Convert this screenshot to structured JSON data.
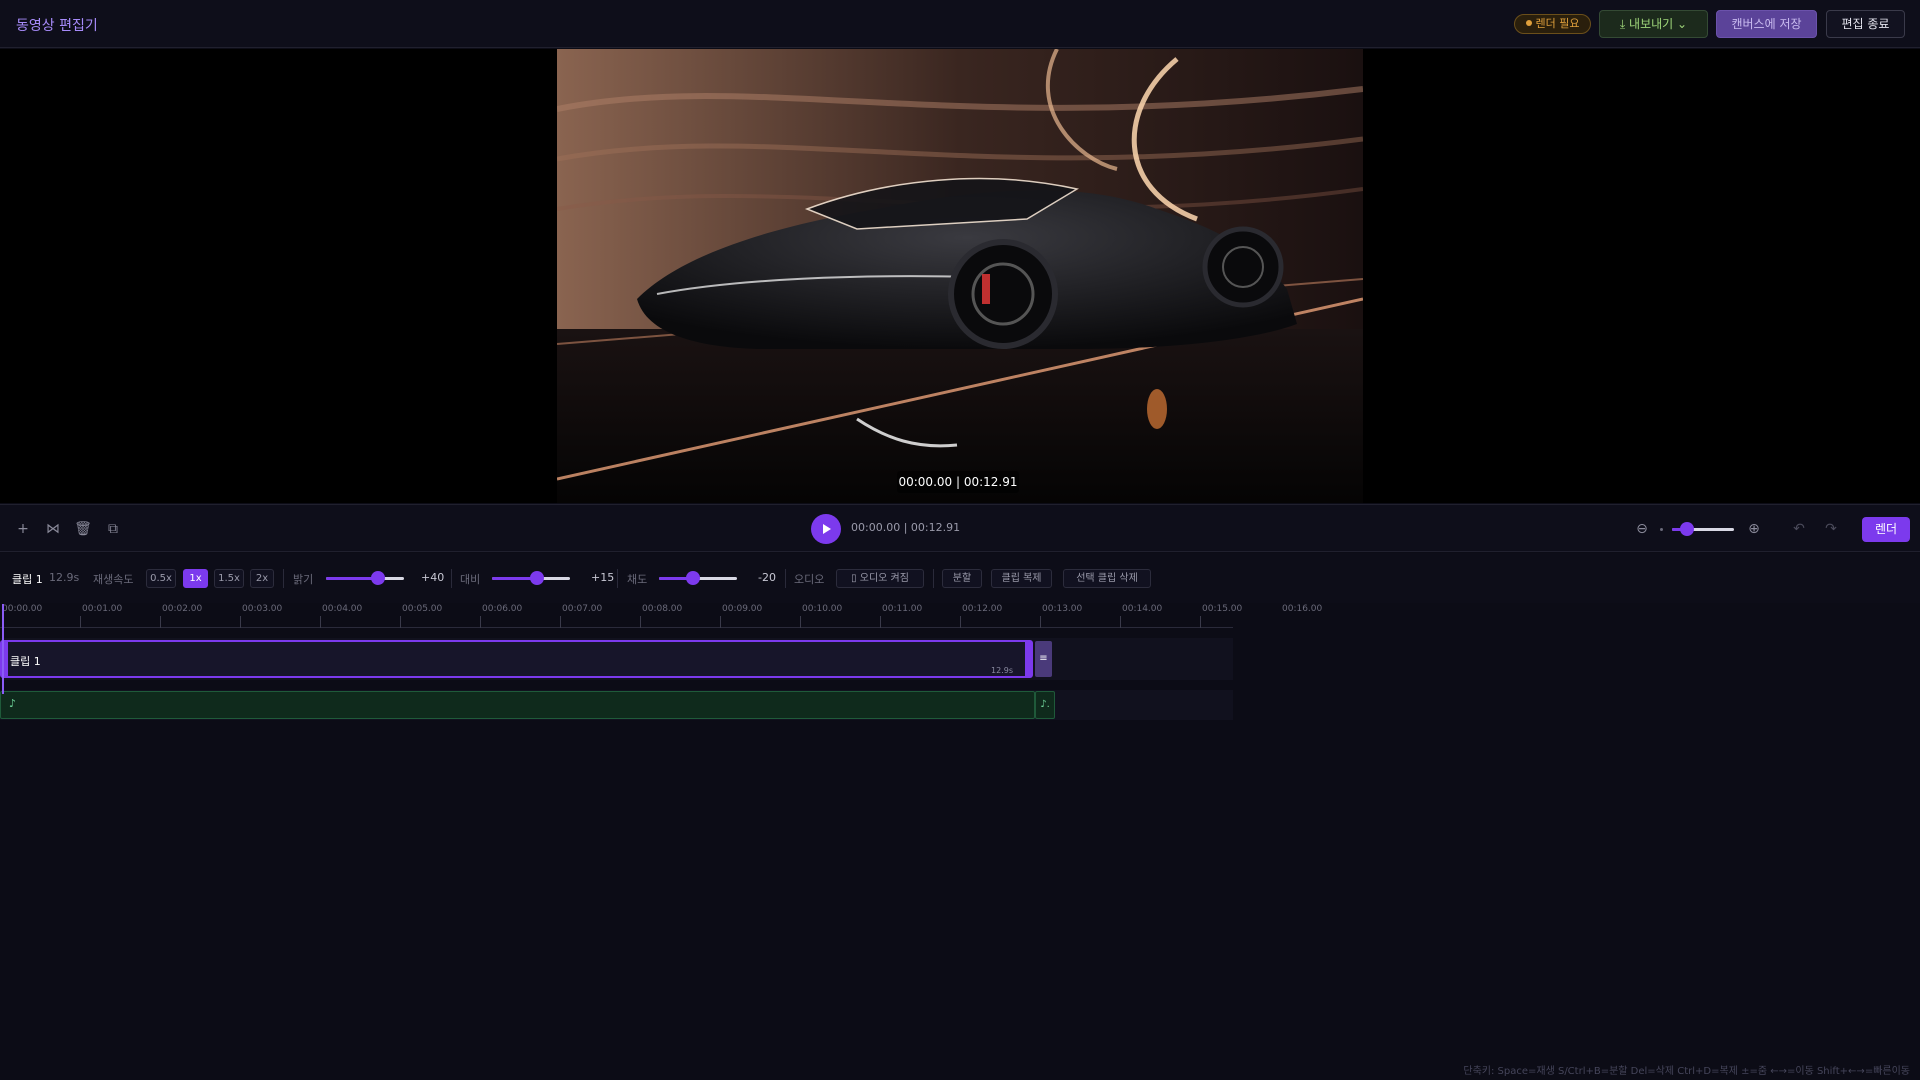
{
  "header": {
    "title": "동영상 편집기",
    "render_needed": "렌더 필요",
    "export_label": "내보내기",
    "save_canvas_label": "캔버스에 저장",
    "exit_label": "편집 종료"
  },
  "preview": {
    "current_time": "00:00.00",
    "total_time": "00:12.91"
  },
  "transport": {
    "time": "00:00.00 | 00:12.91",
    "render_label": "렌더"
  },
  "props": {
    "clip_name": "클립 1",
    "clip_duration": "12.9s",
    "speed_label": "재생속도",
    "speeds": [
      "0.5x",
      "1x",
      "1.5x",
      "2x"
    ],
    "selected_speed": "1x",
    "brightness_label": "밝기",
    "brightness_value": "+40",
    "contrast_label": "대비",
    "contrast_value": "+15",
    "saturation_label": "채도",
    "saturation_value": "-20",
    "audio_label": "오디오",
    "audio_toggle": "▯ 오디오 켜짐",
    "split_label": "분할",
    "duplicate_label": "클립 복제",
    "delete_label": "선택 클립 삭제"
  },
  "timeline": {
    "ticks": [
      "00:00.00",
      "00:01.00",
      "00:02.00",
      "00:03.00",
      "00:04.00",
      "00:05.00",
      "00:06.00",
      "00:07.00",
      "00:08.00",
      "00:09.00",
      "00:10.00",
      "00:11.00",
      "00:12.00",
      "00:13.00",
      "00:14.00",
      "00:15.00",
      "00:16.00"
    ],
    "clip_label": "클립 1",
    "clip_duration": "12.9s",
    "audio_note": "♪",
    "audio_end": "♪."
  },
  "shortcuts": "단축키: Space=재생 S/Ctrl+B=분할 Del=삭제 Ctrl+D=복제 ±=줌 ←→=이동 Shift+←→=빠른이동",
  "colors": {
    "accent": "#7c3aed",
    "background": "#0c0c16",
    "audio": "#0f2a1c"
  }
}
